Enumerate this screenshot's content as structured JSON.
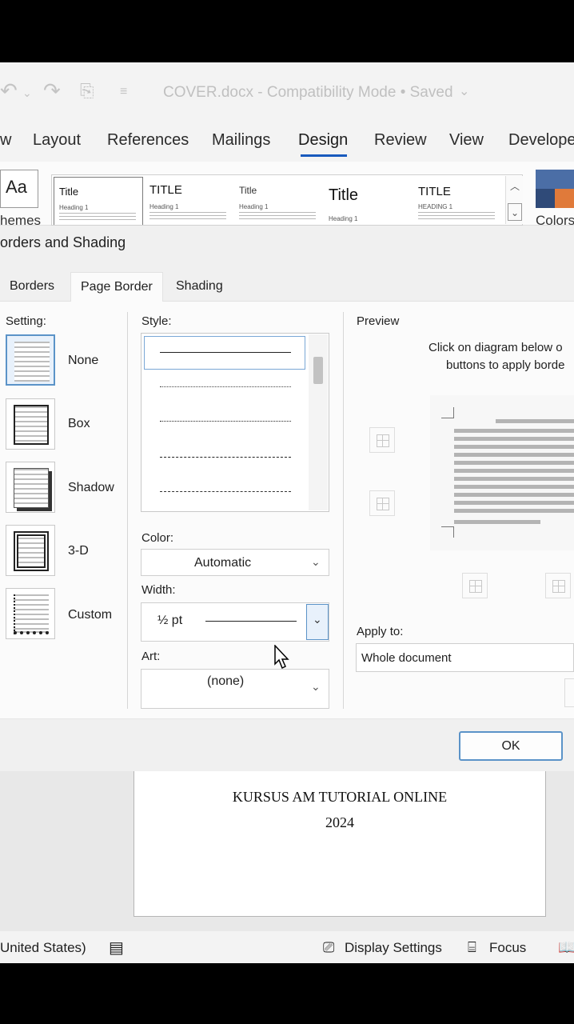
{
  "title_bar": {
    "document_title": "COVER.docx  -  Compatibility Mode • Saved"
  },
  "ribbon": {
    "tabs": [
      "w",
      "Layout",
      "References",
      "Mailings",
      "Design",
      "Review",
      "View",
      "Develope"
    ],
    "active_tab": "Design",
    "themes_label": "hemes",
    "themes_icon_text": "Aa",
    "colors_label": "Colors",
    "style_gallery": [
      {
        "title": "Title",
        "subtitle": "Heading 1",
        "selected": true
      },
      {
        "title": "TITLE",
        "subtitle": "Heading 1",
        "selected": false
      },
      {
        "title": "Title",
        "subtitle": "Heading 1",
        "selected": false
      },
      {
        "title": "Title",
        "subtitle": "Heading 1",
        "selected": false
      },
      {
        "title": "TITLE",
        "subtitle": "HEADING 1",
        "selected": false
      }
    ]
  },
  "dialog": {
    "title": "orders and Shading",
    "tabs": [
      "Borders",
      "Page Border",
      "Shading"
    ],
    "active_tab": "Page Border",
    "setting_label": "Setting:",
    "settings": [
      "None",
      "Box",
      "Shadow",
      "3-D",
      "Custom"
    ],
    "selected_setting": "None",
    "style_label": "Style:",
    "color_label": "Color:",
    "color_value": "Automatic",
    "width_label": "Width:",
    "width_value": "½ pt",
    "art_label": "Art:",
    "art_value": "(none)",
    "preview_label": "Preview",
    "preview_hint_line1": "Click on diagram below o",
    "preview_hint_line2": "buttons to apply borde",
    "apply_to_label": "Apply to:",
    "apply_to_value": "Whole document",
    "ok_label": "OK"
  },
  "document": {
    "line1": "KURSUS AM TUTORIAL ONLINE",
    "line2": "2024"
  },
  "status_bar": {
    "language": "United States)",
    "display_settings": "Display Settings",
    "focus": "Focus"
  },
  "colors": {
    "accent": "#185abd",
    "selection_blue": "#5b93c8"
  }
}
